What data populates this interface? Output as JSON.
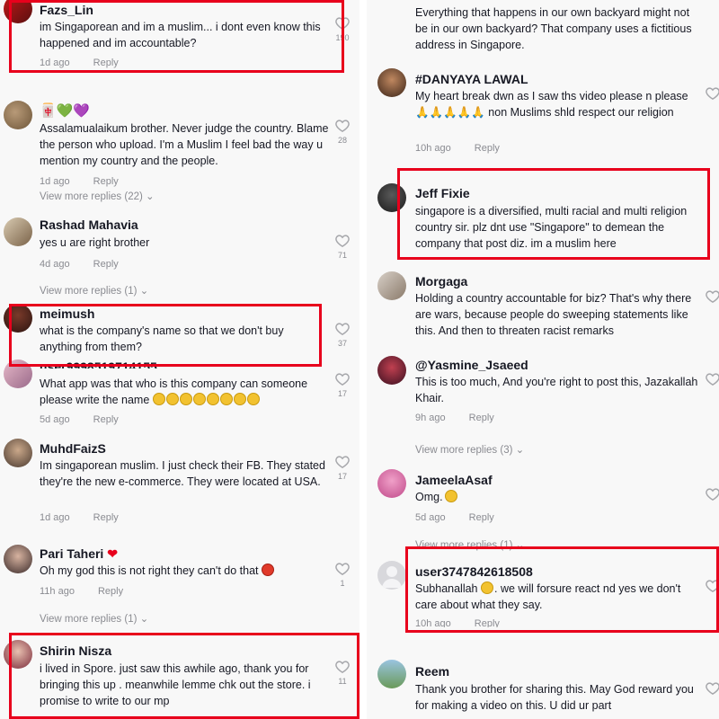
{
  "colors": {
    "highlight": "#e8001c",
    "meta_gray": "#8a8b91",
    "text": "#161823"
  },
  "left_comments": [
    {
      "username": "Fazs_Lin",
      "text": "im Singaporean and im a muslim... i dont even know this happened and im accountable?",
      "time": "1d ago",
      "reply": "Reply",
      "likes": "190"
    },
    {
      "username": "🀄💚💜",
      "text": "Assalamualaikum brother. Never judge the country. Blame the person who upload. I'm a Muslim I feel bad the way u mention my country and the people.",
      "time": "1d ago",
      "reply": "Reply",
      "likes": "28",
      "view_more": "View more replies (22)"
    },
    {
      "username": "Rashad Mahavia",
      "text": "yes u are right brother",
      "time": "4d ago",
      "reply": "Reply",
      "likes": "71",
      "view_more": "View more replies (1)"
    },
    {
      "username": "meimush",
      "text": "what is the company's name so that we don't buy anything from them?",
      "likes": "37"
    },
    {
      "username": "user9998519714155",
      "text": "What app was that who is this company can someone please write the name",
      "time": "5d ago",
      "reply": "Reply",
      "likes": "17"
    },
    {
      "username": "MuhdFaizS",
      "text": "Im singaporean muslim. I just check their FB. They stated they're the new e-commerce. They were located at USA.",
      "time": "1d ago",
      "reply": "Reply",
      "likes": "17"
    },
    {
      "username": "Pari Taheri",
      "text": "Oh my god this is not right they can't do that",
      "time": "11h ago",
      "reply": "Reply",
      "likes": "1",
      "view_more": "View more replies (1)"
    },
    {
      "username": "Shirin Nisza",
      "text": "i lived in Spore. just saw this awhile ago, thank you for bringing this up . meanwhile lemme chk out the store. i promise to write to our mp",
      "likes": "11"
    }
  ],
  "right_comments": [
    {
      "text": "Everything that happens in our own backyard might not be in our own backyard? That company uses a fictitious address in Singapore."
    },
    {
      "username": "#DANYAYA LAWAL",
      "text": "My heart break dwn as I saw ths video please n please 🙏🙏🙏🙏🙏 non Muslims shld respect our religion",
      "time": "10h ago",
      "reply": "Reply"
    },
    {
      "username": "Jeff Fixie",
      "text": "singapore is a diversified, multi racial and multi religion country sir. plz dnt use \"Singapore\" to demean the company that post diz. im a muslim here"
    },
    {
      "username": "Morgaga",
      "text": "Holding a country accountable for biz? That's why there are wars, because people do sweeping statements like this. And then to threaten racist remarks"
    },
    {
      "username": "@Yasmine_Jsaeed",
      "text": "This is too much, And you're right to post this, Jazakallah Khair.",
      "time": "9h ago",
      "reply": "Reply",
      "view_more": "View more replies (3)"
    },
    {
      "username": "JameelaAsaf",
      "text": "Omg.",
      "time": "5d ago",
      "reply": "Reply",
      "view_more": "View more replies (1)"
    },
    {
      "username": "user3747842618508",
      "text_a": "Subhanallah",
      "text_b": ". we will forsure react nd yes we don't care about what they say.",
      "time": "10h ago",
      "reply": "Reply"
    },
    {
      "username": "Reem",
      "text": "Thank you brother for sharing this. May God reward you for making a video on this. U did ur part"
    }
  ]
}
